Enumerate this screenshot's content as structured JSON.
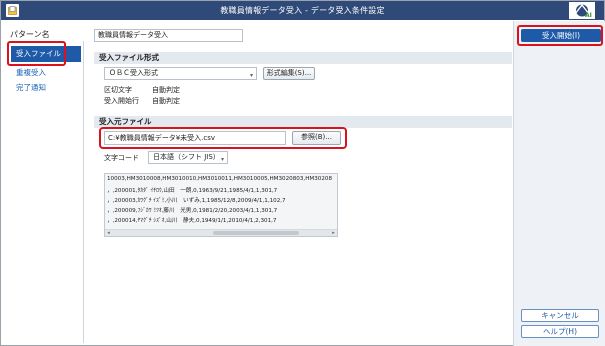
{
  "window": {
    "title": "教職員情報データ受入 - データ受入条件設定",
    "app_icon": "document-folder-icon",
    "badge_icon": "ai-badge-icon"
  },
  "left": {
    "pattern_label": "パターン名",
    "items": [
      {
        "label": "受入ファイル",
        "selected": true
      },
      {
        "label": "重複受入",
        "selected": false
      },
      {
        "label": "完了通知",
        "selected": false
      }
    ]
  },
  "pattern_name_value": "教職員情報データ受入",
  "format_section": {
    "title": "受入ファイル形式",
    "format_value": "ＯＢＣ受入形式",
    "edit_button": "形式編集(S)...",
    "delimiter_label": "区切文字",
    "delimiter_value": "自動判定",
    "start_row_label": "受入開始行",
    "start_row_value": "自動判定"
  },
  "source_section": {
    "title": "受入元ファイル",
    "path_value": "C:¥教職員情報データ¥未受入.csv",
    "browse_button": "参照(B)...",
    "encoding_label": "文字コード",
    "encoding_value": "日本語（シフト JIS）"
  },
  "preview_lines": [
    "10003,HM3010008,HM3010010,HM3010011,HM3010005,HM3020803,HM30208",
    "，,200001,ﾀｶﾀﾞ ｲﾁﾛｳ,山田　一朗,0,1963/9/21,1985/4/1,1,301,7",
    "，,200003,ｶﾜｸﾞﾁ ｲｽﾞﾐ,小川　いずみ,1,1985/12/8,2009/4/1,1,102,7",
    "，,200009,ﾌｼﾞｶﾜ ﾐﾂｵ,藤川　光男,0,1981/2/20,2003/4/1,1,301,7",
    "，,200014,ﾔﾏｸﾞﾁ ｼｽﾞｵ,山川　静夫,0,1949/1/1,2010/4/1,2,301,7"
  ],
  "right": {
    "start_button": "受入開始(I)",
    "cancel_button": "キャンセル",
    "help_button": "ヘルプ(H)"
  },
  "colors": {
    "titlebar": "#2f4a78",
    "accent": "#1e5aa8",
    "highlight_outline": "#d9121d",
    "section_bar": "#e4e9f0"
  }
}
